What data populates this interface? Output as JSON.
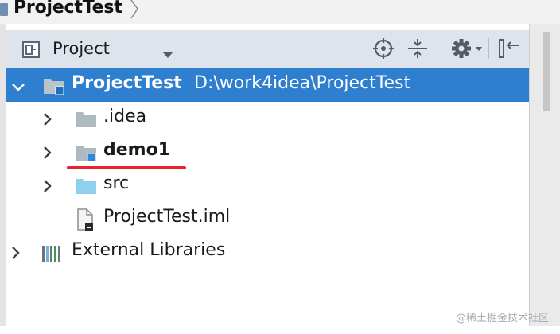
{
  "breadcrumb": {
    "project_name": "ProjectTest"
  },
  "toolbar": {
    "view_label": "Project",
    "icons": [
      "project-view-icon",
      "caret-down-icon",
      "locate-target-icon",
      "collapse-all-icon",
      "gear-icon",
      "hide-panel-icon"
    ]
  },
  "tree": {
    "root": {
      "label": "ProjectTest",
      "path": "D:\\work4idea\\ProjectTest",
      "expanded": true
    },
    "items": [
      {
        "label": ".idea",
        "type": "folder"
      },
      {
        "label": "demo1",
        "type": "module"
      },
      {
        "label": "src",
        "type": "source-folder"
      },
      {
        "label": "ProjectTest.iml",
        "type": "file"
      }
    ],
    "libraries": {
      "label": "External Libraries"
    }
  },
  "watermark": "@稀土掘金技术社区",
  "colors": {
    "selection": "#2f7fd1",
    "toolbar": "#dee4ec",
    "annotation": "#e8222e",
    "folder": "#aeb9c0",
    "source_folder": "#8fd0ef"
  }
}
